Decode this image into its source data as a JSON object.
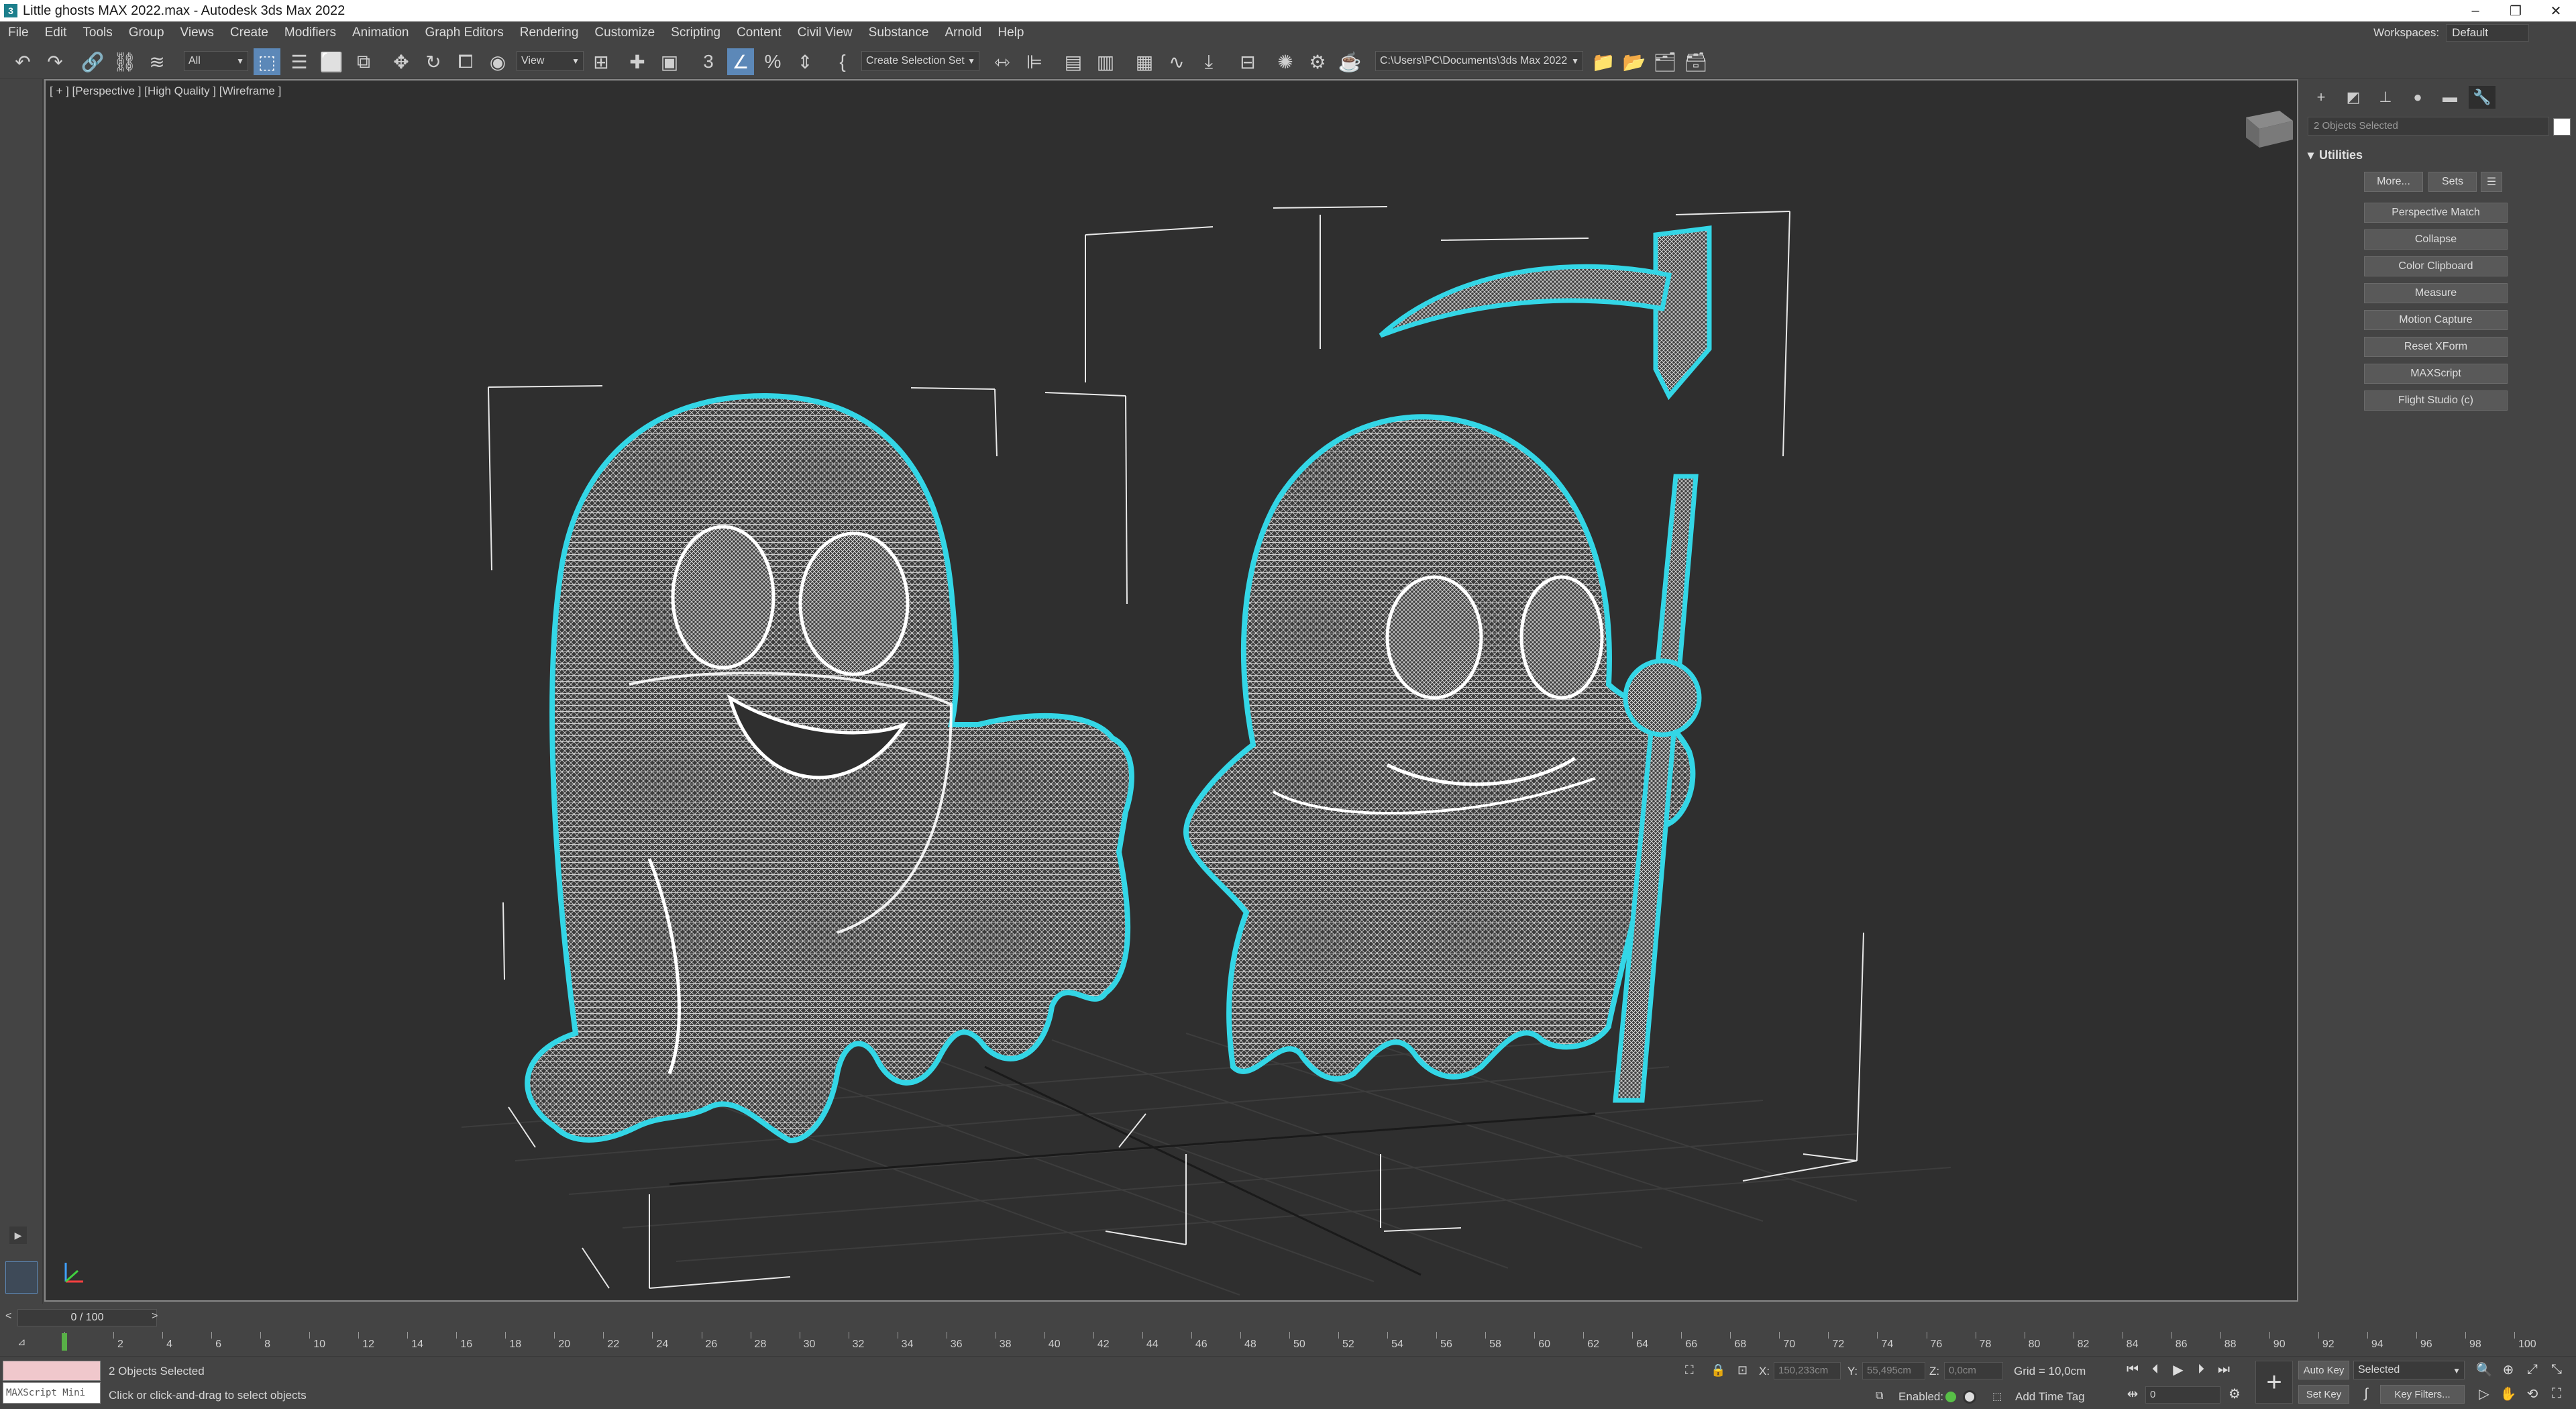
{
  "window": {
    "title": "Little ghosts MAX 2022.max - Autodesk 3ds Max 2022"
  },
  "menu": [
    "File",
    "Edit",
    "Tools",
    "Group",
    "Views",
    "Create",
    "Modifiers",
    "Animation",
    "Graph Editors",
    "Rendering",
    "Customize",
    "Scripting",
    "Content",
    "Civil View",
    "Substance",
    "Arnold",
    "Help"
  ],
  "workspaces": {
    "label": "Workspaces:",
    "value": "Default"
  },
  "toolbar": {
    "selection_filter": "All",
    "ref_coord": "View",
    "named_selection_placeholder": "Create Selection Set",
    "project_path": "C:\\Users\\PC\\Documents\\3ds Max 2022",
    "snap_2d3d": "3",
    "icons": [
      "undo-icon",
      "redo-icon",
      "link-icon",
      "unlink-icon",
      "bind-spacewarp-icon",
      "select-object-icon",
      "select-by-name-icon",
      "rect-region-icon",
      "window-crossing-icon",
      "move-icon",
      "rotate-icon",
      "scale-icon",
      "placement-icon",
      "pivot-icon",
      "snap-icon",
      "angle-snap-icon",
      "percent-snap-icon",
      "spinner-snap-icon",
      "edit-named-sets-icon",
      "mirror-icon",
      "align-icon",
      "layer-explorer-icon",
      "scene-explorer-icon",
      "ribbon-icon",
      "curve-editor-icon",
      "schematic-icon",
      "material-editor-icon",
      "render-setup-icon",
      "render-frame-icon",
      "render-icon"
    ]
  },
  "viewport": {
    "label": "[ + ] [Perspective ] [High Quality ] [Wireframe ]"
  },
  "command_panel": {
    "selection_text": "2 Objects Selected",
    "rollout_title": "Utilities",
    "more_label": "More...",
    "sets_label": "Sets",
    "utilities": [
      "Perspective Match",
      "Collapse",
      "Color Clipboard",
      "Measure",
      "Motion Capture",
      "Reset XForm",
      "MAXScript",
      "Flight Studio (c)"
    ]
  },
  "timeline": {
    "slider_text": "0 / 100",
    "ticks": [
      "0",
      "2",
      "4",
      "6",
      "8",
      "10",
      "12",
      "14",
      "16",
      "18",
      "20",
      "22",
      "24",
      "26",
      "28",
      "30",
      "32",
      "34",
      "36",
      "38",
      "40",
      "42",
      "44",
      "46",
      "48",
      "50",
      "52",
      "54",
      "56",
      "58",
      "60",
      "62",
      "64",
      "66",
      "68",
      "70",
      "72",
      "74",
      "76",
      "78",
      "80",
      "82",
      "84",
      "86",
      "88",
      "90",
      "92",
      "94",
      "96",
      "98",
      "100"
    ],
    "current_frame": 0
  },
  "status": {
    "maxscript": "MAXScript Mini",
    "selected": "2 Objects Selected",
    "prompt": "Click or click-and-drag to select objects",
    "x_label": "X:",
    "x_value": "150,233cm",
    "y_label": "Y:",
    "y_value": "55,495cm",
    "z_label": "Z:",
    "z_value": "0,0cm",
    "grid": "Grid = 10,0cm",
    "enabled_label": "Enabled:",
    "add_time_tag": "Add Time Tag",
    "auto_key": "Auto Key",
    "set_key": "Set Key",
    "key_mode": "Selected",
    "key_filters": "Key Filters...",
    "frame_value": "0"
  },
  "colors": {
    "selection_outline": "#33d6e6",
    "wire": "#f2f2f2",
    "viewport_bg": "#2f2f2f",
    "active_tool": "#5c88b8"
  }
}
